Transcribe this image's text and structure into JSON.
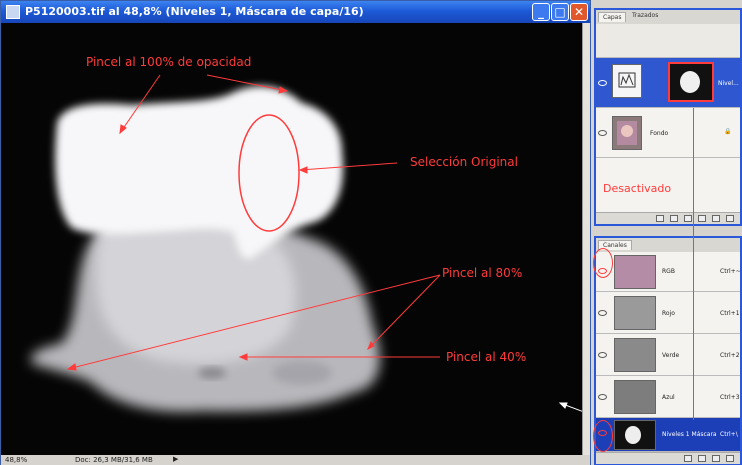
{
  "document": {
    "title": "P5120003.tif al 48,8% (Niveles 1, Máscara de capa/16)",
    "zoom": "48,8%",
    "doc_info": "Doc: 26,3 MB/31,6 MB"
  },
  "annotations": {
    "brush100": "Pincel al 100% de opacidad",
    "selection": "Selección Original",
    "brush80": "Pincel al 80%",
    "brush40": "Pincel al 40%",
    "disabled": "Desactivado"
  },
  "colors": {
    "accent": "#2b58d8",
    "annotation": "#ff3b3b"
  },
  "layers_palette": {
    "tabs": [
      "Capas",
      "Trazados"
    ],
    "layers": [
      {
        "name": "Nivel..."
      },
      {
        "name": "Fondo"
      }
    ]
  },
  "channels_palette": {
    "tab": "Canales",
    "channels": [
      {
        "name": "RGB",
        "shortcut": "Ctrl+~"
      },
      {
        "name": "Rojo",
        "shortcut": "Ctrl+1"
      },
      {
        "name": "Verde",
        "shortcut": "Ctrl+2"
      },
      {
        "name": "Azul",
        "shortcut": "Ctrl+3"
      },
      {
        "name": "Niveles 1 Máscara",
        "shortcut": "Ctrl+\\"
      }
    ]
  }
}
